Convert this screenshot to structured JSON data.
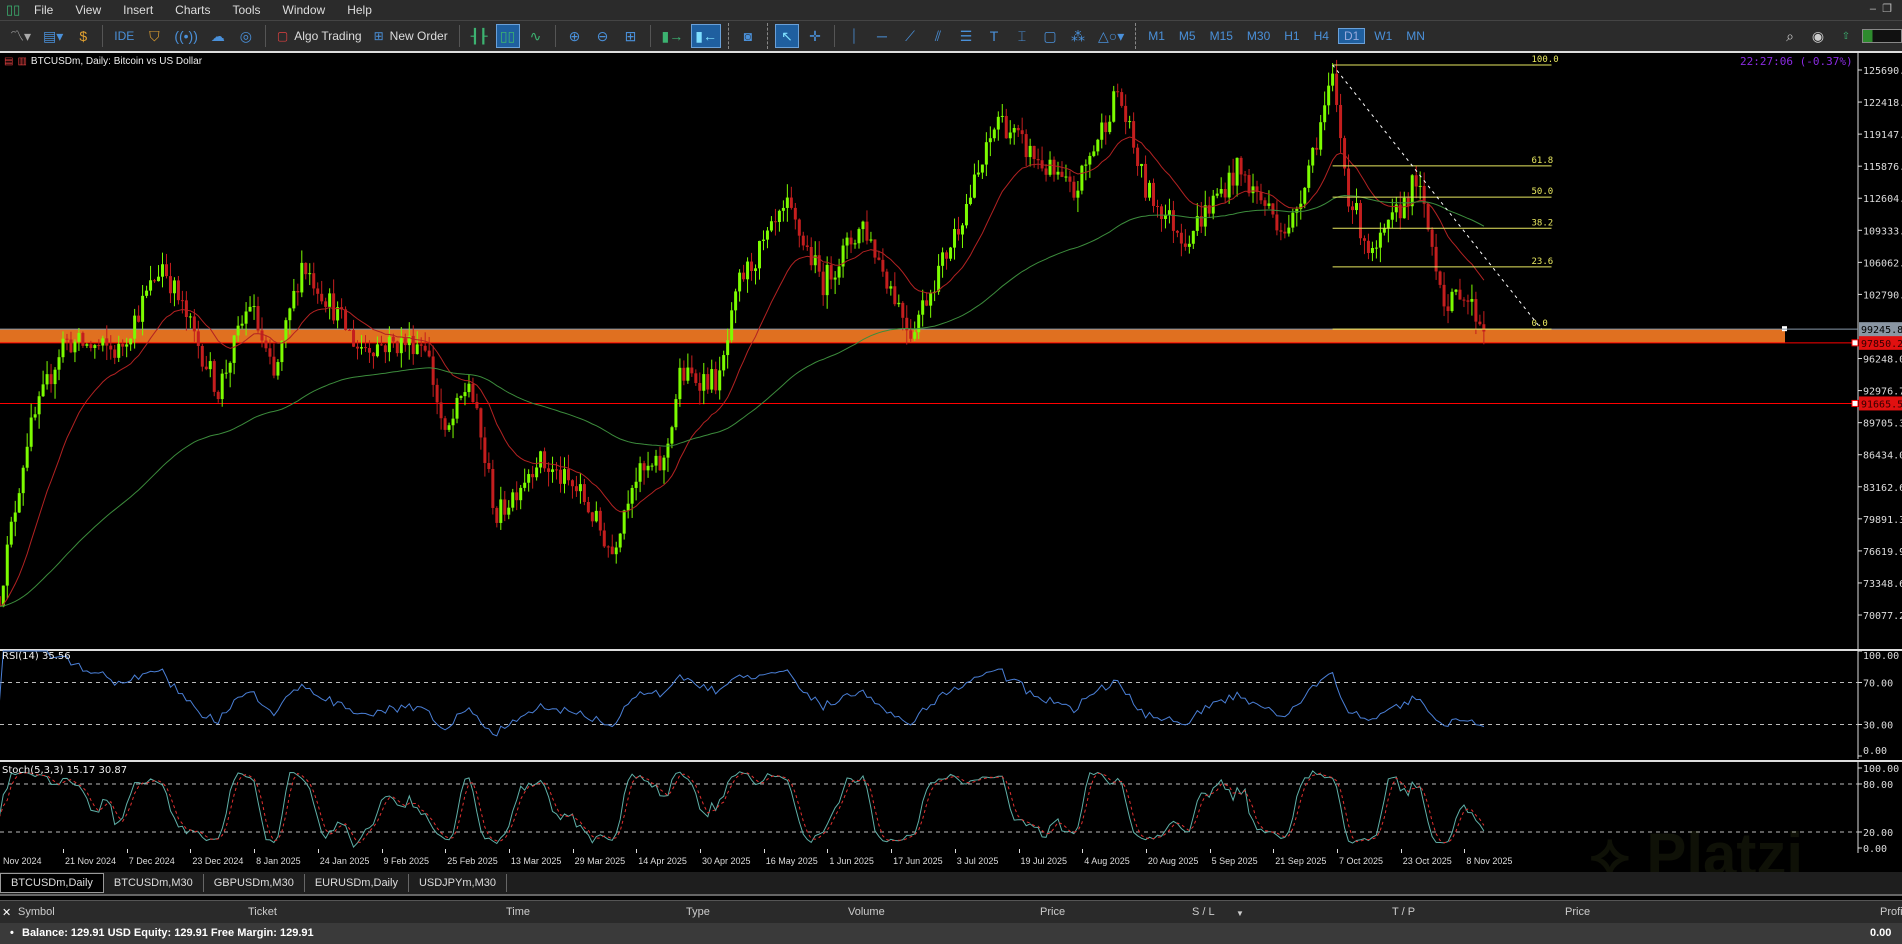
{
  "menu": [
    "File",
    "View",
    "Insert",
    "Charts",
    "Tools",
    "Window",
    "Help"
  ],
  "toolbar": {
    "ide": "IDE",
    "algo_trading": "Algo Trading",
    "new_order": "New Order",
    "timeframes": [
      "M1",
      "M5",
      "M15",
      "M30",
      "H1",
      "H4",
      "D1",
      "W1",
      "MN"
    ],
    "active_timeframe": "D1"
  },
  "chart": {
    "title": "BTCUSDm, Daily:  Bitcoin vs US Dollar",
    "clock": "22:27:06 (-0.37%)",
    "watermark": "Platzi"
  },
  "chart_data": {
    "type": "candlestick",
    "price_ticks": [
      "125690.20",
      "122418.85",
      "119147.50",
      "115876.15",
      "112604.80",
      "109333.45",
      "106062.10",
      "102790.75",
      "96248.05",
      "92976.70",
      "89705.35",
      "86434.00",
      "83162.65",
      "79891.30",
      "76619.95",
      "73348.60",
      "70077.25"
    ],
    "current_price": "99245.86",
    "hlines": [
      {
        "price": "97850.27",
        "color": "#ff0000"
      },
      {
        "price": "91665.57",
        "color": "#ff0000"
      }
    ],
    "zone": {
      "from": 97850,
      "to": 99245,
      "color": "#e07020"
    },
    "fibonacci": {
      "high": 126200,
      "low": 99245,
      "from": "2025-10-06",
      "to": "2025-11-30",
      "levels": [
        "100.0",
        "61.8",
        "50.0",
        "38.2",
        "23.6",
        "0.0"
      ]
    },
    "close_path": [
      [
        "2024-11-05",
        72000
      ],
      [
        "2024-11-12",
        88000
      ],
      [
        "2024-11-21",
        98000
      ],
      [
        "2024-12-05",
        97000
      ],
      [
        "2024-12-16",
        106000
      ],
      [
        "2024-12-30",
        93000
      ],
      [
        "2025-01-07",
        102000
      ],
      [
        "2025-01-13",
        94000
      ],
      [
        "2025-01-20",
        106000
      ],
      [
        "2025-01-27",
        102000
      ],
      [
        "2025-02-03",
        97500
      ],
      [
        "2025-02-20",
        98000
      ],
      [
        "2025-02-25",
        88000
      ],
      [
        "2025-03-03",
        94000
      ],
      [
        "2025-03-10",
        80000
      ],
      [
        "2025-03-20",
        86000
      ],
      [
        "2025-03-31",
        82500
      ],
      [
        "2025-04-08",
        76500
      ],
      [
        "2025-04-13",
        84000
      ],
      [
        "2025-04-21",
        85500
      ],
      [
        "2025-04-25",
        94500
      ],
      [
        "2025-05-05",
        94000
      ],
      [
        "2025-05-10",
        104000
      ],
      [
        "2025-05-22",
        111500
      ],
      [
        "2025-05-31",
        104000
      ],
      [
        "2025-06-10",
        110000
      ],
      [
        "2025-06-22",
        99000
      ],
      [
        "2025-07-01",
        107000
      ],
      [
        "2025-07-10",
        116000
      ],
      [
        "2025-07-14",
        121000
      ],
      [
        "2025-07-20",
        118000
      ],
      [
        "2025-08-02",
        113000
      ],
      [
        "2025-08-13",
        123500
      ],
      [
        "2025-08-20",
        113500
      ],
      [
        "2025-08-30",
        108500
      ],
      [
        "2025-09-12",
        115500
      ],
      [
        "2025-09-25",
        109000
      ],
      [
        "2025-10-06",
        124500
      ],
      [
        "2025-10-10",
        113000
      ],
      [
        "2025-10-16",
        106500
      ],
      [
        "2025-10-27",
        114500
      ],
      [
        "2025-11-04",
        101000
      ],
      [
        "2025-11-07",
        103500
      ],
      [
        "2025-11-13",
        99500
      ]
    ],
    "colors": {
      "bull": "#7cfc00",
      "bear": "#c41e1e",
      "ma_fast": "#b22222",
      "ma_slow": "#3c8c3c",
      "rsi": "#4a7fd6",
      "stoch_main": "#5fb0a8",
      "stoch_signal": "#e03030"
    },
    "time_labels": [
      "Nov 2024",
      "21 Nov 2024",
      "7 Dec 2024",
      "23 Dec 2024",
      "8 Jan 2025",
      "24 Jan 2025",
      "9 Feb 2025",
      "25 Feb 2025",
      "13 Mar 2025",
      "29 Mar 2025",
      "14 Apr 2025",
      "30 Apr 2025",
      "16 May 2025",
      "1 Jun 2025",
      "17 Jun 2025",
      "3 Jul 2025",
      "19 Jul 2025",
      "4 Aug 2025",
      "20 Aug 2025",
      "5 Sep 2025",
      "21 Sep 2025",
      "7 Oct 2025",
      "23 Oct 2025",
      "8 Nov 2025"
    ]
  },
  "rsi": {
    "label": "RSI(14) 35.56",
    "ticks": [
      "100.00",
      "70.00",
      "30.00",
      "0.00"
    ]
  },
  "stoch": {
    "label": "Stoch(5,3,3) 15.17 30.87",
    "ticks": [
      "100.00",
      "80.00",
      "20.00",
      "0.00"
    ]
  },
  "tabs": [
    "BTCUSDm,Daily",
    "BTCUSDm,M30",
    "GBPUSDm,M30",
    "EURUSDm,Daily",
    "USDJPYm,M30"
  ],
  "table": {
    "headers": [
      "Symbol",
      "Ticket",
      "Time",
      "Type",
      "Volume",
      "Price",
      "S / L",
      "T / P",
      "Price",
      "Profit"
    ],
    "balance": "Balance: 129.91 USD  Equity: 129.91  Free Margin: 129.91",
    "profit": "0.00"
  }
}
